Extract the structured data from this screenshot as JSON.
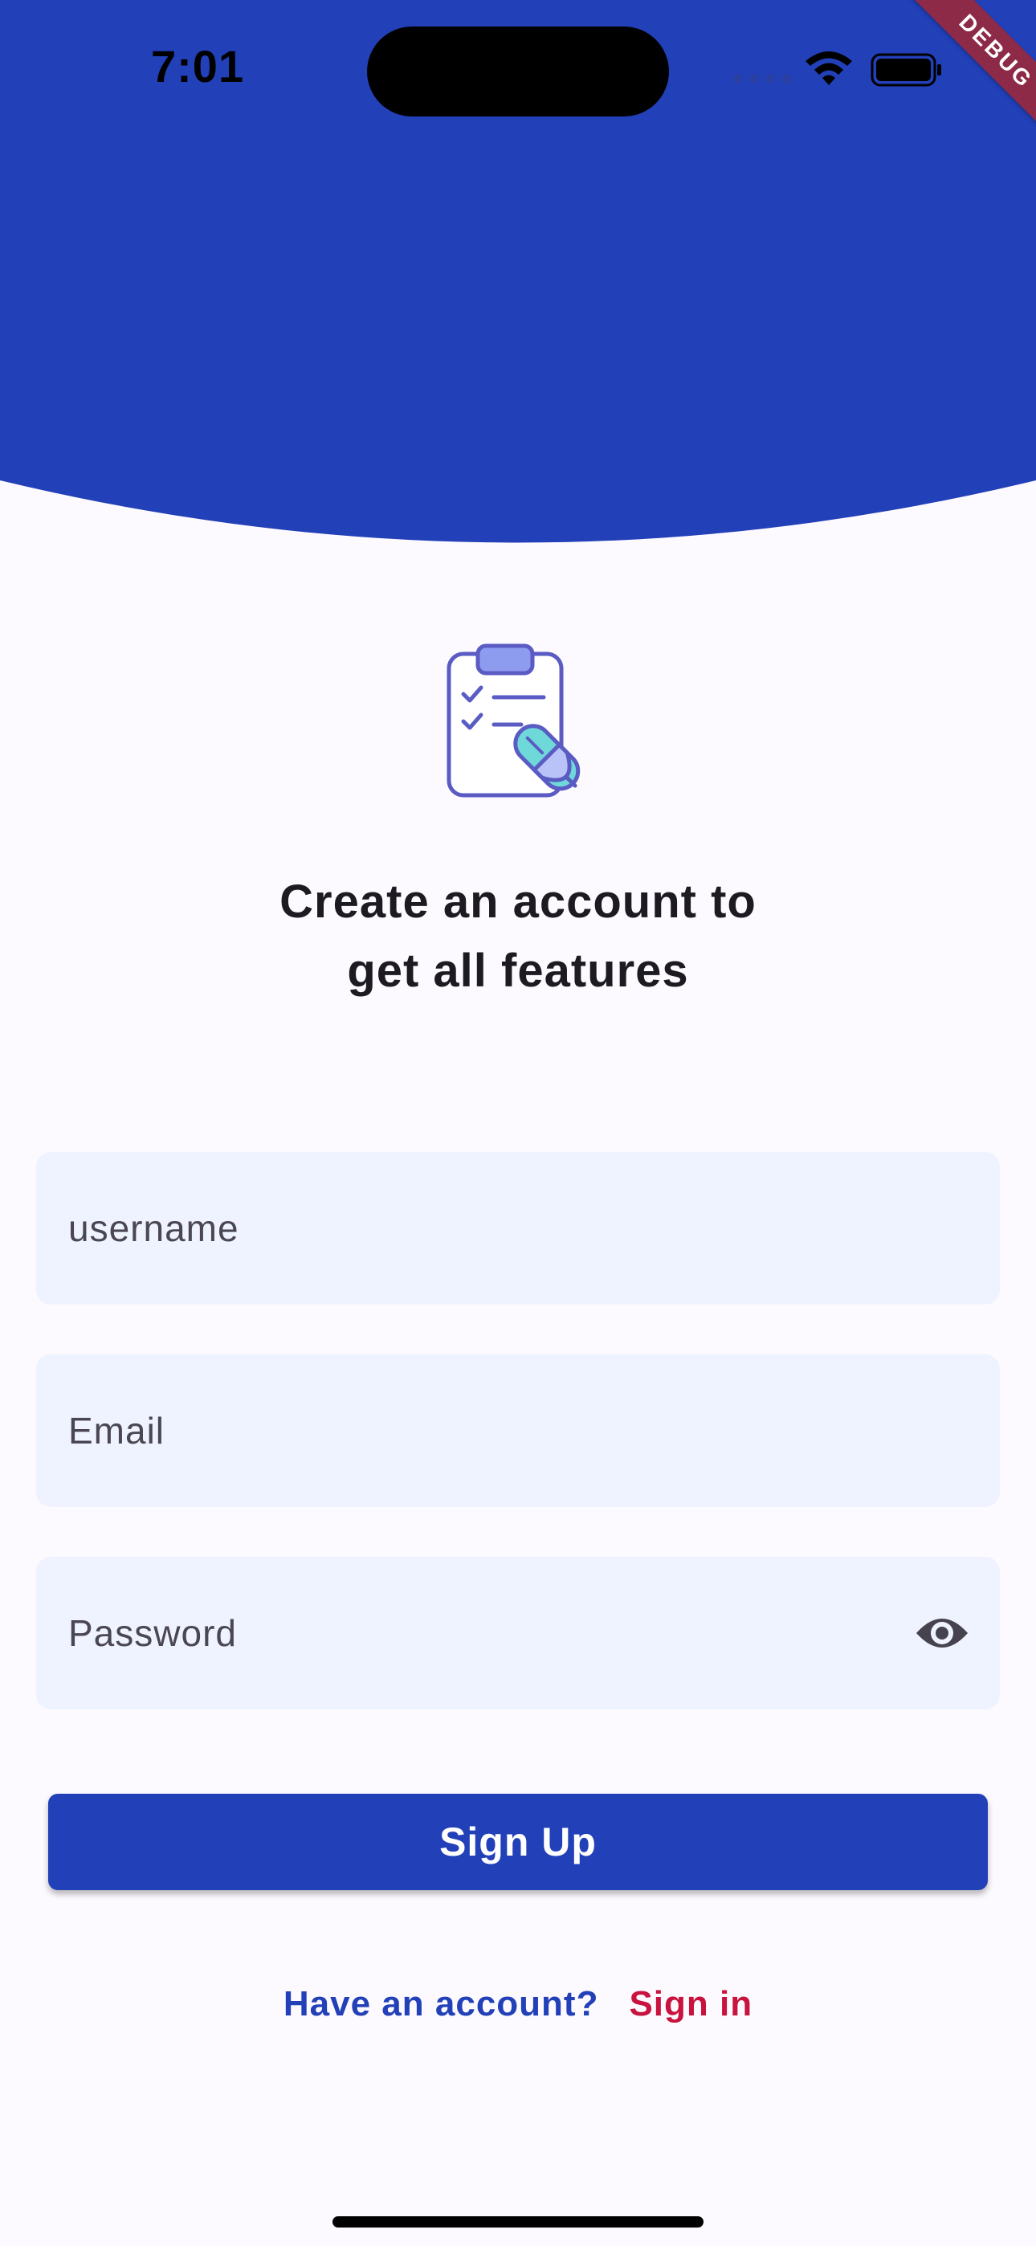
{
  "status_bar": {
    "time": "7:01",
    "wifi_icon": "wifi-icon",
    "battery_icon": "battery-icon",
    "cellular_icon": "cellular-dots-icon"
  },
  "debug_banner": {
    "label": "DEBUG"
  },
  "illustration": {
    "icon": "clipboard-checklist-pen-icon"
  },
  "heading": {
    "line1": "Create an account to",
    "line2": "get all features"
  },
  "form": {
    "username_placeholder": "username",
    "username_value": "",
    "email_placeholder": "Email",
    "email_value": "",
    "password_placeholder": "Password",
    "password_value": "",
    "password_toggle_icon": "eye-icon"
  },
  "actions": {
    "signup_label": "Sign Up"
  },
  "footer": {
    "have_account_text": "Have an account?",
    "signin_label": "Sign in"
  },
  "colors": {
    "primary": "#2240b8",
    "accent": "#c8133f",
    "field_background": "#eef3ff",
    "page_background": "#fdfaff",
    "heading_text": "#1d1b22"
  }
}
